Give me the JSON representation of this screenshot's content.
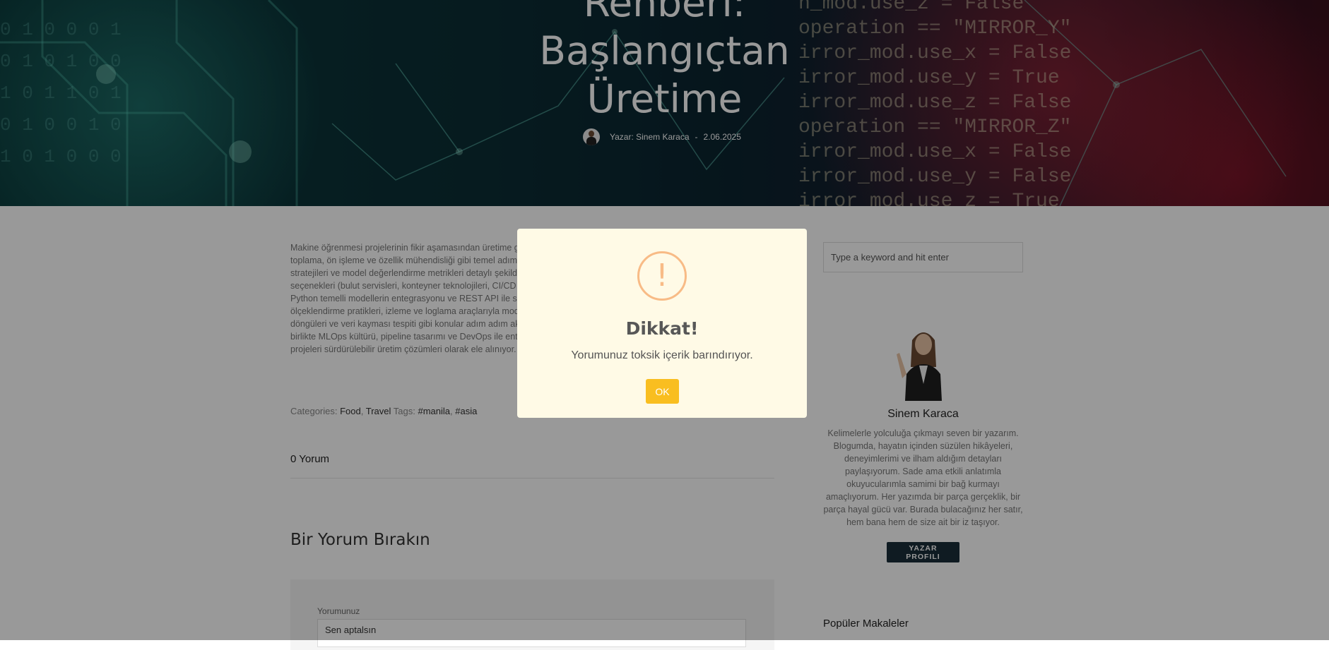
{
  "hero": {
    "title_lines": [
      "Rehberi:",
      "Başlangıçtan",
      "Üretime"
    ],
    "author": "Yazar: Sinem Karaca",
    "separator": "-",
    "date": "2.06.2025",
    "code_text": "n_mod.use_z = False\noperation == \"MIRROR_Y\"\nirror_mod.use_x = False\nirror_mod.use_y = True\nirror_mod.use_z = False\noperation == \"MIRROR_Z\"\nirror_mod.use_x = False\nirror_mod.use_y = False\nirror_mod.use_z = True",
    "binary_text": "0 1 0 0 0 1\n0 1 0 1 0 0\n1 0 1 1 0 1\n0 1 0 0 1 0\n1 0 1 0 0 0"
  },
  "article": {
    "body": "Makine öğrenmesi projelerinin fikir aşamasından üretime geçişine kadar tüm süreç bu rehberde adım adım sunuluyor. Veri toplama, ön işleme ve özellik mühendisliği gibi temel adımların yanı sıra model seçimi, hiperparametre optimizasyonu stratejileri ve model değerlendirme metrikleri detaylı şekilde ele alınıyor. Modelin üretime taşınması için gerekli altyapı seçenekleri (bulut servisleri, konteyner teknolojileri, CI/CD süreçleri) açıklanıyor; .NET ekosisteminde ML.NET kullanımı, Python temelli modellerin entegrasyonu ve REST API ile servis edilmesi anlatılıyor. Kubernetes veya serverless altyapıda ölçeklendirme pratikleri, izleme ve loglama araçlarıyla model performansının canlı ortamda takibi, geri bakım (retraining) döngüleri ve veri kayması tespiti gibi konular adım adım aktarılıyor. Ayrıca, ekip içi iş akışı ve dokümantasyon önerileriyle birlikte MLOps kültürü, pipeline tasarımı ve DevOps ile entegrasyon senaryoları yer alıyor. Böylece makine öğrenmesi projeleri sürdürülebilir üretim çözümleri olarak ele alınıyor.",
    "categories_label": "Categories:",
    "categories": [
      "Food",
      "Travel"
    ],
    "tags_label": "Tags:",
    "tags": [
      "#manila",
      "#asia"
    ],
    "comments_count": "0 Yorum",
    "leave_comment_title": "Bir Yorum Bırakın",
    "comment_label": "Yorumunuz",
    "comment_value": "Sen aptalsın"
  },
  "sidebar": {
    "search_placeholder": "Type a keyword and hit enter",
    "author_name": "Sinem Karaca",
    "author_bio": "Kelimelerle yolculuğa çıkmayı seven bir yazarım. Blogumda, hayatın içinden süzülen hikâyeleri, deneyimlerimi ve ilham aldığım detayları paylaşıyorum. Sade ama etkili anlatımla okuyucularımla samimi bir bağ kurmayı amaçlıyorum. Her yazımda bir parça gerçeklik, bir parça hayal gücü var. Burada bulacağınız her satır, hem bana hem de size ait bir iz taşıyor.",
    "author_button": "YAZAR PROFILI",
    "popular_title": "Popüler Makaleler"
  },
  "modal": {
    "icon": "warning-icon",
    "icon_glyph": "!",
    "title": "Dikkat!",
    "text": "Yorumunuz toksik içerik barındırıyor.",
    "ok_label": "OK"
  },
  "colors": {
    "modal_bg": "#fffae6",
    "ok_button": "#f9be20",
    "warning_ring": "#f8bb86",
    "author_button_bg": "#1a2e3a"
  }
}
